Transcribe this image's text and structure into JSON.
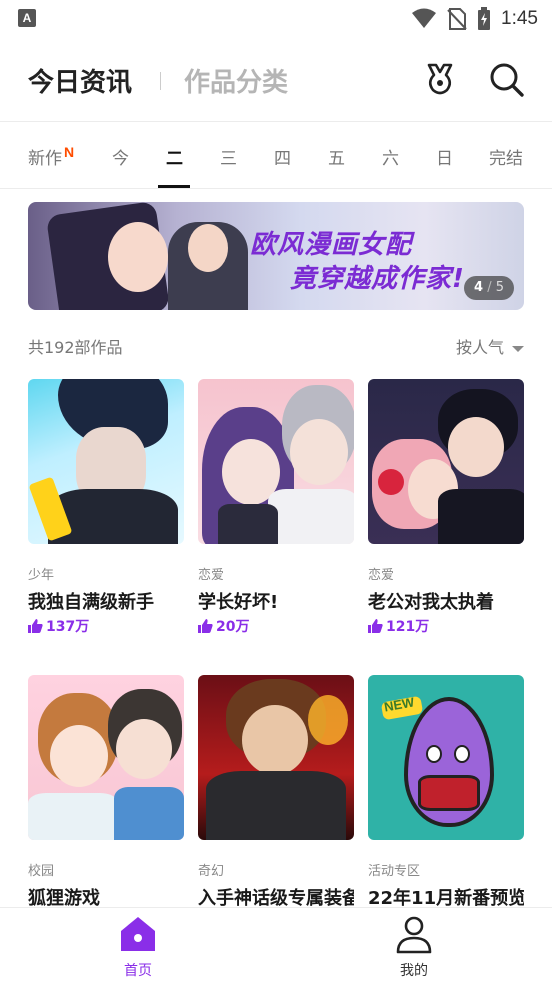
{
  "status_bar": {
    "time": "1:45"
  },
  "header": {
    "tab_active": "今日资讯",
    "tab_inactive": "作品分类"
  },
  "day_tabs": [
    {
      "label": "新作",
      "badge": "N",
      "active": false
    },
    {
      "label": "今",
      "active": false
    },
    {
      "label": "二",
      "active": true
    },
    {
      "label": "三",
      "active": false
    },
    {
      "label": "四",
      "active": false
    },
    {
      "label": "五",
      "active": false
    },
    {
      "label": "六",
      "active": false
    },
    {
      "label": "日",
      "active": false
    },
    {
      "label": "完结",
      "active": false
    }
  ],
  "banner": {
    "title_line1": "欧风漫画女配",
    "title_line2": "竟穿越成作家!",
    "pager_current": "4",
    "pager_sep": "/",
    "pager_total": "5"
  },
  "list_info": {
    "count": "共192部作品",
    "sort": "按人气"
  },
  "cards": [
    {
      "genre": "少年",
      "title": "我独自满级新手",
      "likes": "137万"
    },
    {
      "genre": "恋爱",
      "title": "学长好坏!",
      "likes": "20万"
    },
    {
      "genre": "恋爱",
      "title": "老公对我太执着",
      "likes": "121万"
    },
    {
      "genre": "校园",
      "title": "狐狸游戏",
      "likes": ""
    },
    {
      "genre": "奇幻",
      "title": "入手神话级专属装备",
      "likes": ""
    },
    {
      "genre": "活动专区",
      "title": "22年11月新番预览",
      "likes": "",
      "cover_text": "NEW"
    }
  ],
  "bottom_nav": {
    "home": "首页",
    "me": "我的"
  },
  "colors": {
    "accent": "#8a2ee8",
    "new_badge": "#ff4d00"
  }
}
